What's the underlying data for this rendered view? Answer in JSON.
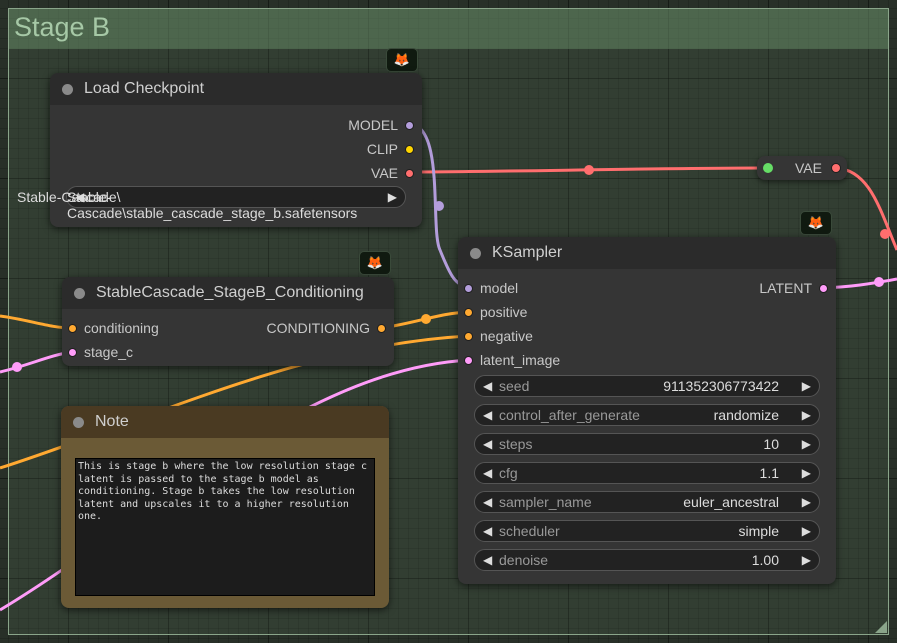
{
  "group": {
    "title": "Stage B"
  },
  "badge_icon": "fox-icon",
  "load_checkpoint": {
    "title": "Load Checkpoint",
    "outputs": [
      "MODEL",
      "CLIP",
      "VAE"
    ],
    "ckpt_name_label": "Stable-Cascade\\",
    "ckpt_name_value": "Stable-Cascade\\stable_cascade_stage_b.safetensors"
  },
  "reroute_vae": {
    "label": "VAE"
  },
  "conditioning_node": {
    "title": "StableCascade_StageB_Conditioning",
    "inputs": [
      "conditioning",
      "stage_c"
    ],
    "outputs": [
      "CONDITIONING"
    ]
  },
  "ksampler": {
    "title": "KSampler",
    "inputs": [
      "model",
      "positive",
      "negative",
      "latent_image"
    ],
    "outputs": [
      "LATENT"
    ],
    "widgets": [
      {
        "name": "seed",
        "value": "911352306773422"
      },
      {
        "name": "control_after_generate",
        "value": "randomize"
      },
      {
        "name": "steps",
        "value": "10"
      },
      {
        "name": "cfg",
        "value": "1.1"
      },
      {
        "name": "sampler_name",
        "value": "euler_ancestral"
      },
      {
        "name": "scheduler",
        "value": "simple"
      },
      {
        "name": "denoise",
        "value": "1.00"
      }
    ]
  },
  "note": {
    "title": "Note",
    "text": "This is stage b where the low resolution stage c latent is passed to the stage b model as conditioning. Stage b takes the low resolution latent and upscales it to a higher resolution one."
  },
  "colors": {
    "model": "#b39ddb",
    "clip": "#ffd500",
    "vae": "#ff6e6e",
    "conditioning": "#ffa931",
    "latent": "#ff9cf9",
    "wire_vae": "#ff6e6e"
  }
}
